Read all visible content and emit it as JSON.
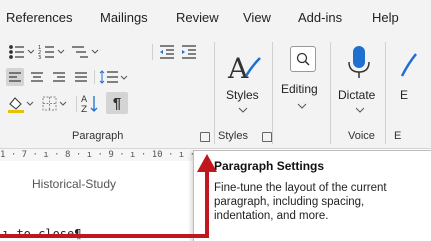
{
  "menu": {
    "tabs": [
      "References",
      "Mailings",
      "Review",
      "View",
      "Add-ins",
      "Help"
    ]
  },
  "ribbon": {
    "paragraph_group_label": "Paragraph",
    "styles_button_label": "Styles",
    "styles_group_label": "Styles",
    "editing_button_label": "Editing",
    "dictate_button_label": "Dictate",
    "voice_group_label": "Voice",
    "next_button_label_partial": "E",
    "next_group_label_partial": "E",
    "sort_label": "Z↓",
    "sort_label_top": "A"
  },
  "ruler": {
    "text": "1 · 7 · ı · 8 · ı · 9 · ı · 10 · ı ·"
  },
  "document": {
    "heading_text": "Historical-Study",
    "body_text": "ı-to-close¶"
  },
  "tooltip": {
    "title": "Paragraph Settings",
    "description": "Fine-tune the layout of the current paragraph, including spacing, indentation, and more."
  },
  "colors": {
    "ribbon_bg": "#f3f3f3",
    "annotation_red": "#c0171f",
    "dictate_blue": "#1f6fd1"
  }
}
